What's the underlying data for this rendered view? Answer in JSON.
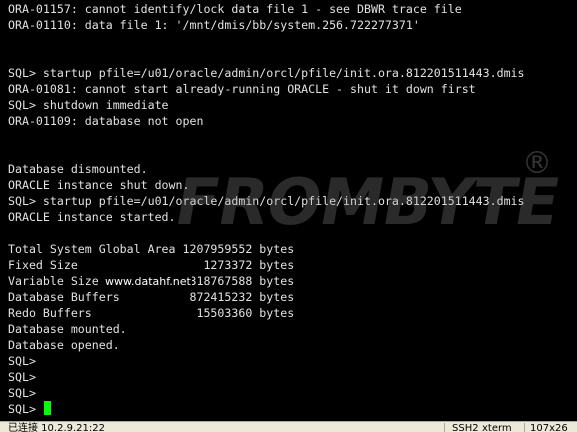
{
  "terminal": {
    "lines": [
      "ORA-01157: cannot identify/lock data file 1 - see DBWR trace file",
      "ORA-01110: data file 1: '/mnt/dmis/bb/system.256.722277371'",
      "",
      "",
      "SQL> startup pfile=/u01/oracle/admin/orcl/pfile/init.ora.812201511443.dmis",
      "ORA-01081: cannot start already-running ORACLE - shut it down first",
      "SQL> shutdown immediate",
      "ORA-01109: database not open",
      "",
      "",
      "Database dismounted.",
      "ORACLE instance shut down.",
      "SQL> startup pfile=/u01/oracle/admin/orcl/pfile/init.ora.812201511443.dmis",
      "ORACLE instance started.",
      "",
      "Total System Global Area 1207959552 bytes",
      "Fixed Size                  1273372 bytes",
      "Variable Size             318767588 bytes",
      "Database Buffers          872415232 bytes",
      "Redo Buffers               15503360 bytes",
      "Database mounted.",
      "Database opened.",
      "SQL>",
      "SQL>",
      "SQL>",
      "SQL> "
    ],
    "cursor_color": "#00ff00",
    "text_color": "#e2e2e2",
    "background_color": "#000000"
  },
  "watermark": {
    "brand": "FROMBYTE",
    "registered_mark": "®",
    "site": "www.datahf.net"
  },
  "statusbar": {
    "connection": "已连接 10.2.9.21:22",
    "protocol": "SSH2",
    "terminal_type": "xterm",
    "size": "107x26"
  }
}
